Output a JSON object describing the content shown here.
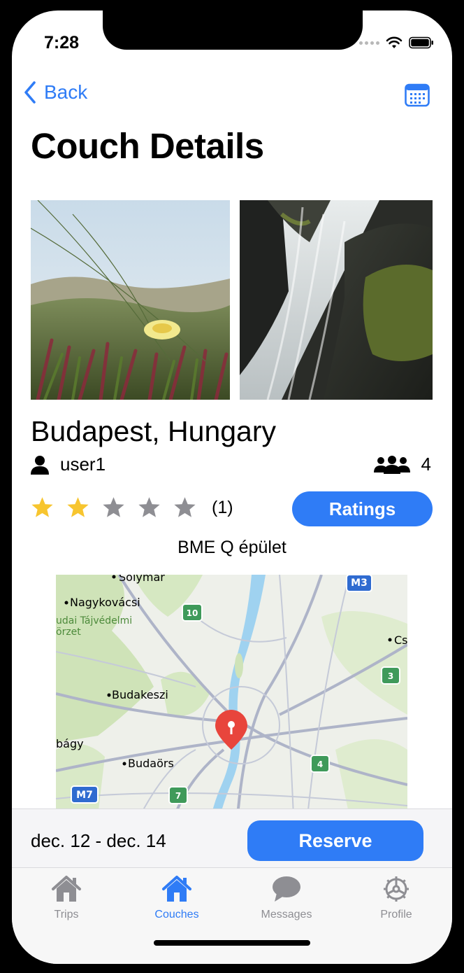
{
  "status_bar": {
    "time": "7:28"
  },
  "nav": {
    "back_label": "Back",
    "title": "Couch Details"
  },
  "couch": {
    "location": "Budapest, Hungary",
    "host": "user1",
    "capacity": "4",
    "rating": {
      "value": 2,
      "max": 5,
      "count_label": "(1)"
    },
    "ratings_button": "Ratings",
    "place_name": "BME Q épület"
  },
  "map": {
    "labels": {
      "solymar": "Solymar",
      "nagykovacsi": "Nagykovácsi",
      "tajvedelmi": "udai Tájvédelmi",
      "korzet": "örzet",
      "budakeszi": "Budakeszi",
      "bagy": "bágy",
      "budaors": "Budaörs",
      "cs": "Cs"
    },
    "road_shields": {
      "m3": "M3",
      "r10": "10",
      "r3": "3",
      "r4": "4",
      "r7": "7",
      "m7": "M7"
    }
  },
  "reservation": {
    "date_range": "dec. 12 - dec. 14",
    "reserve_label": "Reserve"
  },
  "tabs": [
    {
      "label": "Trips",
      "active": false
    },
    {
      "label": "Couches",
      "active": true
    },
    {
      "label": "Messages",
      "active": false
    },
    {
      "label": "Profile",
      "active": false
    }
  ],
  "colors": {
    "accent": "#2f7cf6",
    "star_filled": "#f7c52f",
    "star_empty": "#8e8e93",
    "map_pin": "#e8453c",
    "tab_inactive": "#8e8e93"
  },
  "icons": {
    "back": "chevron-left-icon",
    "calendar": "calendar-icon",
    "host": "person-icon",
    "capacity": "people-group-icon",
    "star": "star-icon",
    "pin": "map-pin-icon",
    "trips": "house-icon",
    "couches": "house-icon",
    "messages": "speech-bubble-icon",
    "profile": "gear-icon"
  }
}
